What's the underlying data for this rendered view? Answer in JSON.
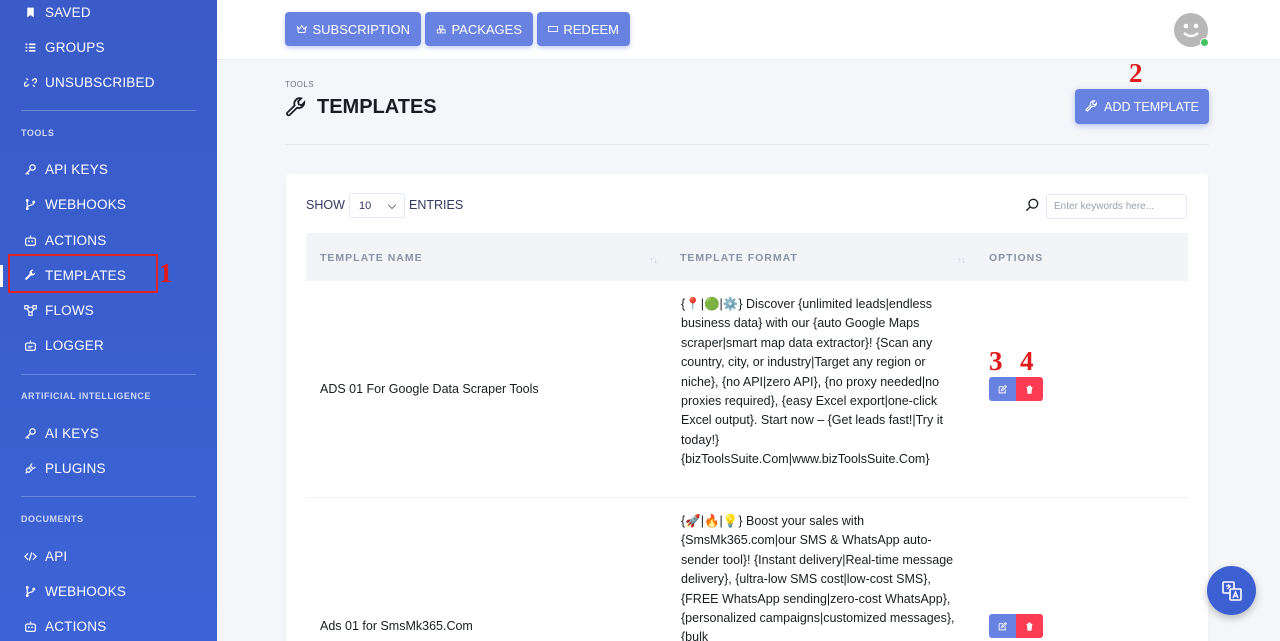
{
  "sidebar": {
    "items": [
      {
        "label": "SAVED",
        "icon": "bookmark-icon"
      },
      {
        "label": "GROUPS",
        "icon": "list-icon"
      },
      {
        "label": "UNSUBSCRIBED",
        "icon": "unlink-icon"
      },
      {
        "label": "API KEYS",
        "icon": "key-icon"
      },
      {
        "label": "WEBHOOKS",
        "icon": "branch-icon"
      },
      {
        "label": "ACTIONS",
        "icon": "robot-icon"
      },
      {
        "label": "TEMPLATES",
        "icon": "wrench-icon"
      },
      {
        "label": "FLOWS",
        "icon": "flow-icon"
      },
      {
        "label": "LOGGER",
        "icon": "logger-icon"
      },
      {
        "label": "AI KEYS",
        "icon": "key-icon"
      },
      {
        "label": "PLUGINS",
        "icon": "plug-icon"
      },
      {
        "label": "API",
        "icon": "code-icon"
      },
      {
        "label": "WEBHOOKS",
        "icon": "branch-icon"
      },
      {
        "label": "ACTIONS",
        "icon": "robot-icon"
      }
    ],
    "sections": {
      "tools": "TOOLS",
      "ai": "ARTIFICIAL INTELLIGENCE",
      "documents": "DOCUMENTS"
    },
    "active": "TEMPLATES"
  },
  "topbar": {
    "subscription": "SUBSCRIPTION",
    "packages": "PACKAGES",
    "redeem": "REDEEM"
  },
  "header": {
    "crumb": "TOOLS",
    "title": "TEMPLATES",
    "add_button": "ADD TEMPLATE"
  },
  "table": {
    "show_label": "SHOW",
    "page_size": "10",
    "entries_label": "ENTRIES",
    "search_placeholder": "Enter keywords here...",
    "columns": [
      "TEMPLATE NAME",
      "TEMPLATE FORMAT",
      "OPTIONS"
    ],
    "rows": [
      {
        "name": "ADS 01 For Google Data Scraper Tools",
        "format": "{📍|🟢|⚙️} Discover {unlimited leads|endless business data} with our {auto Google Maps scraper|smart map data extractor}! {Scan any country, city, or industry|Target any region or niche}, {no API|zero API}, {no proxy needed|no proxies required}, {easy Excel export|one-click Excel output}. Start now – {Get leads fast!|Try it today!} {bizToolsSuite.Com|www.bizToolsSuite.Com}"
      },
      {
        "name": "Ads 01 for SmsMk365.Com",
        "format": "{🚀|🔥|💡} Boost your sales with {SmsMk365.com|our SMS & WhatsApp auto-sender tool}! {Instant delivery|Real-time message delivery}, {ultra-low SMS cost|low-cost SMS}, {FREE WhatsApp sending|zero-cost WhatsApp}, {personalized campaigns|customized messages}, {bulk"
      }
    ]
  },
  "annotations": [
    "1",
    "2",
    "3",
    "4"
  ],
  "colors": {
    "sidebar": "#3a5bc8",
    "accent": "#6782e0",
    "danger": "#fc3c53",
    "annotation": "#e01b1b"
  }
}
